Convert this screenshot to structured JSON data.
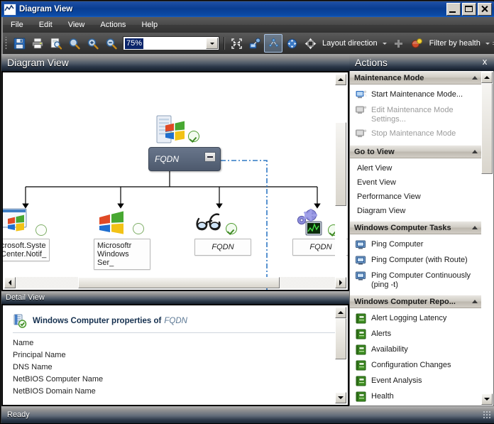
{
  "window": {
    "title": "Diagram View",
    "icon": "diagram-view-icon",
    "minimize_label": "Minimize",
    "maximize_label": "Maximize",
    "close_label": "Close"
  },
  "menu": {
    "items": [
      {
        "label": "File"
      },
      {
        "label": "Edit"
      },
      {
        "label": "View"
      },
      {
        "label": "Actions"
      },
      {
        "label": "Help"
      }
    ]
  },
  "toolbar": {
    "buttons": [
      {
        "name": "save-icon",
        "tooltip": "Save"
      },
      {
        "name": "print-icon",
        "tooltip": "Print"
      },
      {
        "name": "print-preview-icon",
        "tooltip": "Print Preview"
      },
      {
        "name": "zoom-icon",
        "tooltip": "Zoom"
      },
      {
        "name": "zoom-in-icon",
        "tooltip": "Zoom In"
      },
      {
        "name": "zoom-out-icon",
        "tooltip": "Zoom Out"
      }
    ],
    "zoom": {
      "value": "75%",
      "placeholder": ""
    },
    "buttons2": [
      {
        "name": "fit-to-screen-icon",
        "tooltip": "Fit to Screen"
      },
      {
        "name": "network-layout-icon",
        "tooltip": "Network Layout"
      },
      {
        "name": "diagram-layout-icon",
        "tooltip": "Diagram Layout",
        "selected": true
      },
      {
        "name": "pan-icon",
        "tooltip": "Pan"
      }
    ],
    "layout_direction": {
      "label": "Layout direction",
      "icon": "layout-direction-icon"
    },
    "filter_by_health": {
      "label": "Filter by health",
      "icon": "filter-health-icon"
    }
  },
  "diagram_panel": {
    "title": "Diagram View",
    "nodes": [
      {
        "id": "root",
        "label": "FQDN",
        "icon": "windows-computer-icon",
        "health": "ok",
        "selected": true
      },
      {
        "id": "n1",
        "label": "crosoft.Syste\nCenter.Notif_",
        "icon": "notification-icon",
        "health": "blank",
        "selected": false
      },
      {
        "id": "n2",
        "label": "Microsoftr\nWindows Ser_",
        "icon": "windows-icon",
        "health": "blank",
        "selected": false
      },
      {
        "id": "n3",
        "label": "FQDN",
        "icon": "health-service-icon",
        "health": "ok",
        "selected": false
      },
      {
        "id": "n4",
        "label": "FQDN",
        "icon": "performance-icon",
        "health": "ok",
        "selected": false
      }
    ]
  },
  "detail_panel": {
    "title": "Detail View",
    "heading": "Windows Computer properties of",
    "heading_target": "FQDN",
    "icon": "windows-computer-properties-icon",
    "properties": [
      "Name",
      "Principal Name",
      "DNS Name",
      "NetBIOS Computer Name",
      "NetBIOS Domain Name"
    ]
  },
  "actions_panel": {
    "title": "Actions",
    "close_label": "x",
    "sections": [
      {
        "title": "Maintenance Mode",
        "items": [
          {
            "label": "Start Maintenance Mode...",
            "icon": "maintenance-start-icon",
            "disabled": false
          },
          {
            "label": "Edit Maintenance Mode Settings...",
            "icon": "maintenance-edit-icon",
            "disabled": true
          },
          {
            "label": "Stop Maintenance Mode",
            "icon": "maintenance-stop-icon",
            "disabled": true
          }
        ]
      },
      {
        "title": "Go to View",
        "items": [
          {
            "label": "Alert View",
            "icon": "",
            "disabled": false
          },
          {
            "label": "Event View",
            "icon": "",
            "disabled": false
          },
          {
            "label": "Performance View",
            "icon": "",
            "disabled": false
          },
          {
            "label": "Diagram View",
            "icon": "",
            "disabled": false
          }
        ]
      },
      {
        "title": "Windows Computer Tasks",
        "items": [
          {
            "label": "Ping Computer",
            "icon": "ping-computer-icon",
            "disabled": false
          },
          {
            "label": "Ping Computer (with Route)",
            "icon": "ping-computer-icon",
            "disabled": false
          },
          {
            "label": "Ping Computer Continuously (ping -t)",
            "icon": "ping-computer-icon",
            "disabled": false
          }
        ]
      },
      {
        "title": "Windows Computer Repo...",
        "items": [
          {
            "label": "Alert Logging Latency",
            "icon": "report-icon",
            "disabled": false
          },
          {
            "label": "Alerts",
            "icon": "report-icon",
            "disabled": false
          },
          {
            "label": "Availability",
            "icon": "report-icon",
            "disabled": false
          },
          {
            "label": "Configuration Changes",
            "icon": "report-icon",
            "disabled": false
          },
          {
            "label": "Event Analysis",
            "icon": "report-icon",
            "disabled": false
          },
          {
            "label": "Health",
            "icon": "report-icon",
            "disabled": false
          }
        ]
      }
    ]
  },
  "statusbar": {
    "text": "Ready"
  },
  "colors": {
    "titlebar": "#0a3d91",
    "selected_node": "#5b687d",
    "health_ok": "#4e9b2f",
    "dashed_link": "#2f78c4",
    "section_header": "#cfcbc3"
  }
}
